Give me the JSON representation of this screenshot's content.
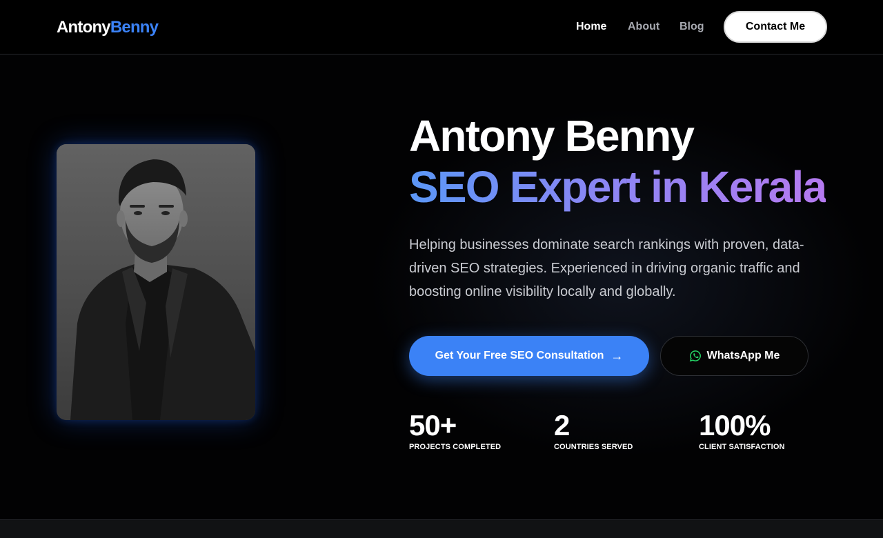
{
  "header": {
    "logo_first": "Antony",
    "logo_second": "Benny",
    "nav": [
      {
        "label": "Home",
        "active": true
      },
      {
        "label": "About",
        "active": false
      },
      {
        "label": "Blog",
        "active": false
      }
    ],
    "contact_label": "Contact Me"
  },
  "hero": {
    "title": "Antony Benny",
    "subtitle": "SEO Expert in Kerala",
    "description": "Helping businesses dominate search rankings with proven, data-driven SEO strategies. Experienced in driving organic traffic and boosting online visibility locally and globally.",
    "primary_cta": "Get Your Free SEO Consultation",
    "primary_cta_icon": "arrow-right-icon",
    "secondary_cta": "WhatsApp Me",
    "secondary_cta_icon": "whatsapp-icon"
  },
  "stats": [
    {
      "value": "50+",
      "label": "PROJECTS COMPLETED"
    },
    {
      "value": "2",
      "label": "COUNTRIES SERVED"
    },
    {
      "value": "100%",
      "label": "CLIENT SATISFACTION"
    }
  ],
  "colors": {
    "accent": "#3b82f6",
    "gradient_start": "#5b97f7",
    "gradient_end": "#b57af0",
    "whatsapp": "#25d366",
    "background": "#000000"
  }
}
